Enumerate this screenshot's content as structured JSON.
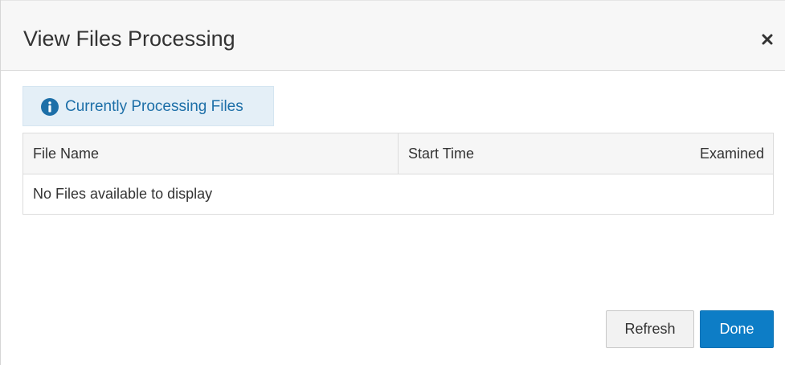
{
  "dialog": {
    "title": "View Files Processing",
    "close_icon": "close-icon"
  },
  "banner": {
    "icon": "info-icon",
    "text": "Currently Processing Files"
  },
  "table": {
    "columns": [
      "File Name",
      "Start Time",
      "Examined"
    ],
    "empty_message": "No Files available to display"
  },
  "footer": {
    "refresh_label": "Refresh",
    "done_label": "Done"
  },
  "colors": {
    "primary": "#0d7dc6",
    "banner_bg": "#e4eff7",
    "banner_text": "#1d6fa8"
  }
}
